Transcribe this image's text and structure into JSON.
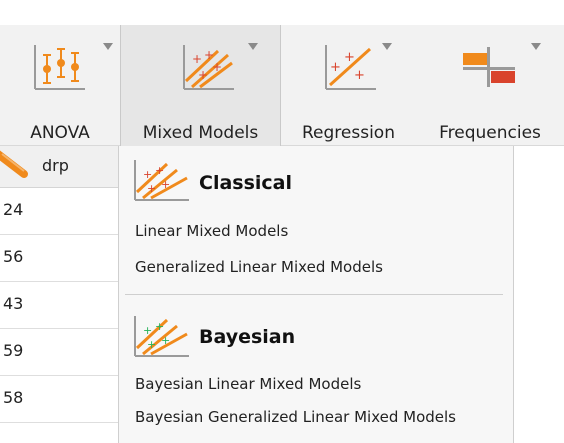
{
  "toolbar": {
    "items": [
      {
        "label": "ANOVA",
        "icon": "anova-icon"
      },
      {
        "label": "Mixed Models",
        "icon": "mixed-models-icon"
      },
      {
        "label": "Regression",
        "icon": "regression-icon"
      },
      {
        "label": "Frequencies",
        "icon": "frequencies-icon"
      }
    ]
  },
  "table": {
    "column_header": "drp",
    "rows": [
      "24",
      "56",
      "43",
      "59",
      "58"
    ]
  },
  "menu": {
    "sections": [
      {
        "title": "Classical",
        "icon": "classical-icon",
        "items": [
          "Linear Mixed Models",
          "Generalized Linear Mixed Models"
        ]
      },
      {
        "title": "Bayesian",
        "icon": "bayesian-icon",
        "items": [
          "Bayesian Linear Mixed Models",
          "Bayesian Generalized Linear Mixed Models"
        ]
      }
    ]
  },
  "colors": {
    "orange": "#f08a1c",
    "red": "#d9432c",
    "green": "#27b35a",
    "toolbar_bg": "#f2f2f2",
    "menu_bg": "#f7f7f7"
  }
}
